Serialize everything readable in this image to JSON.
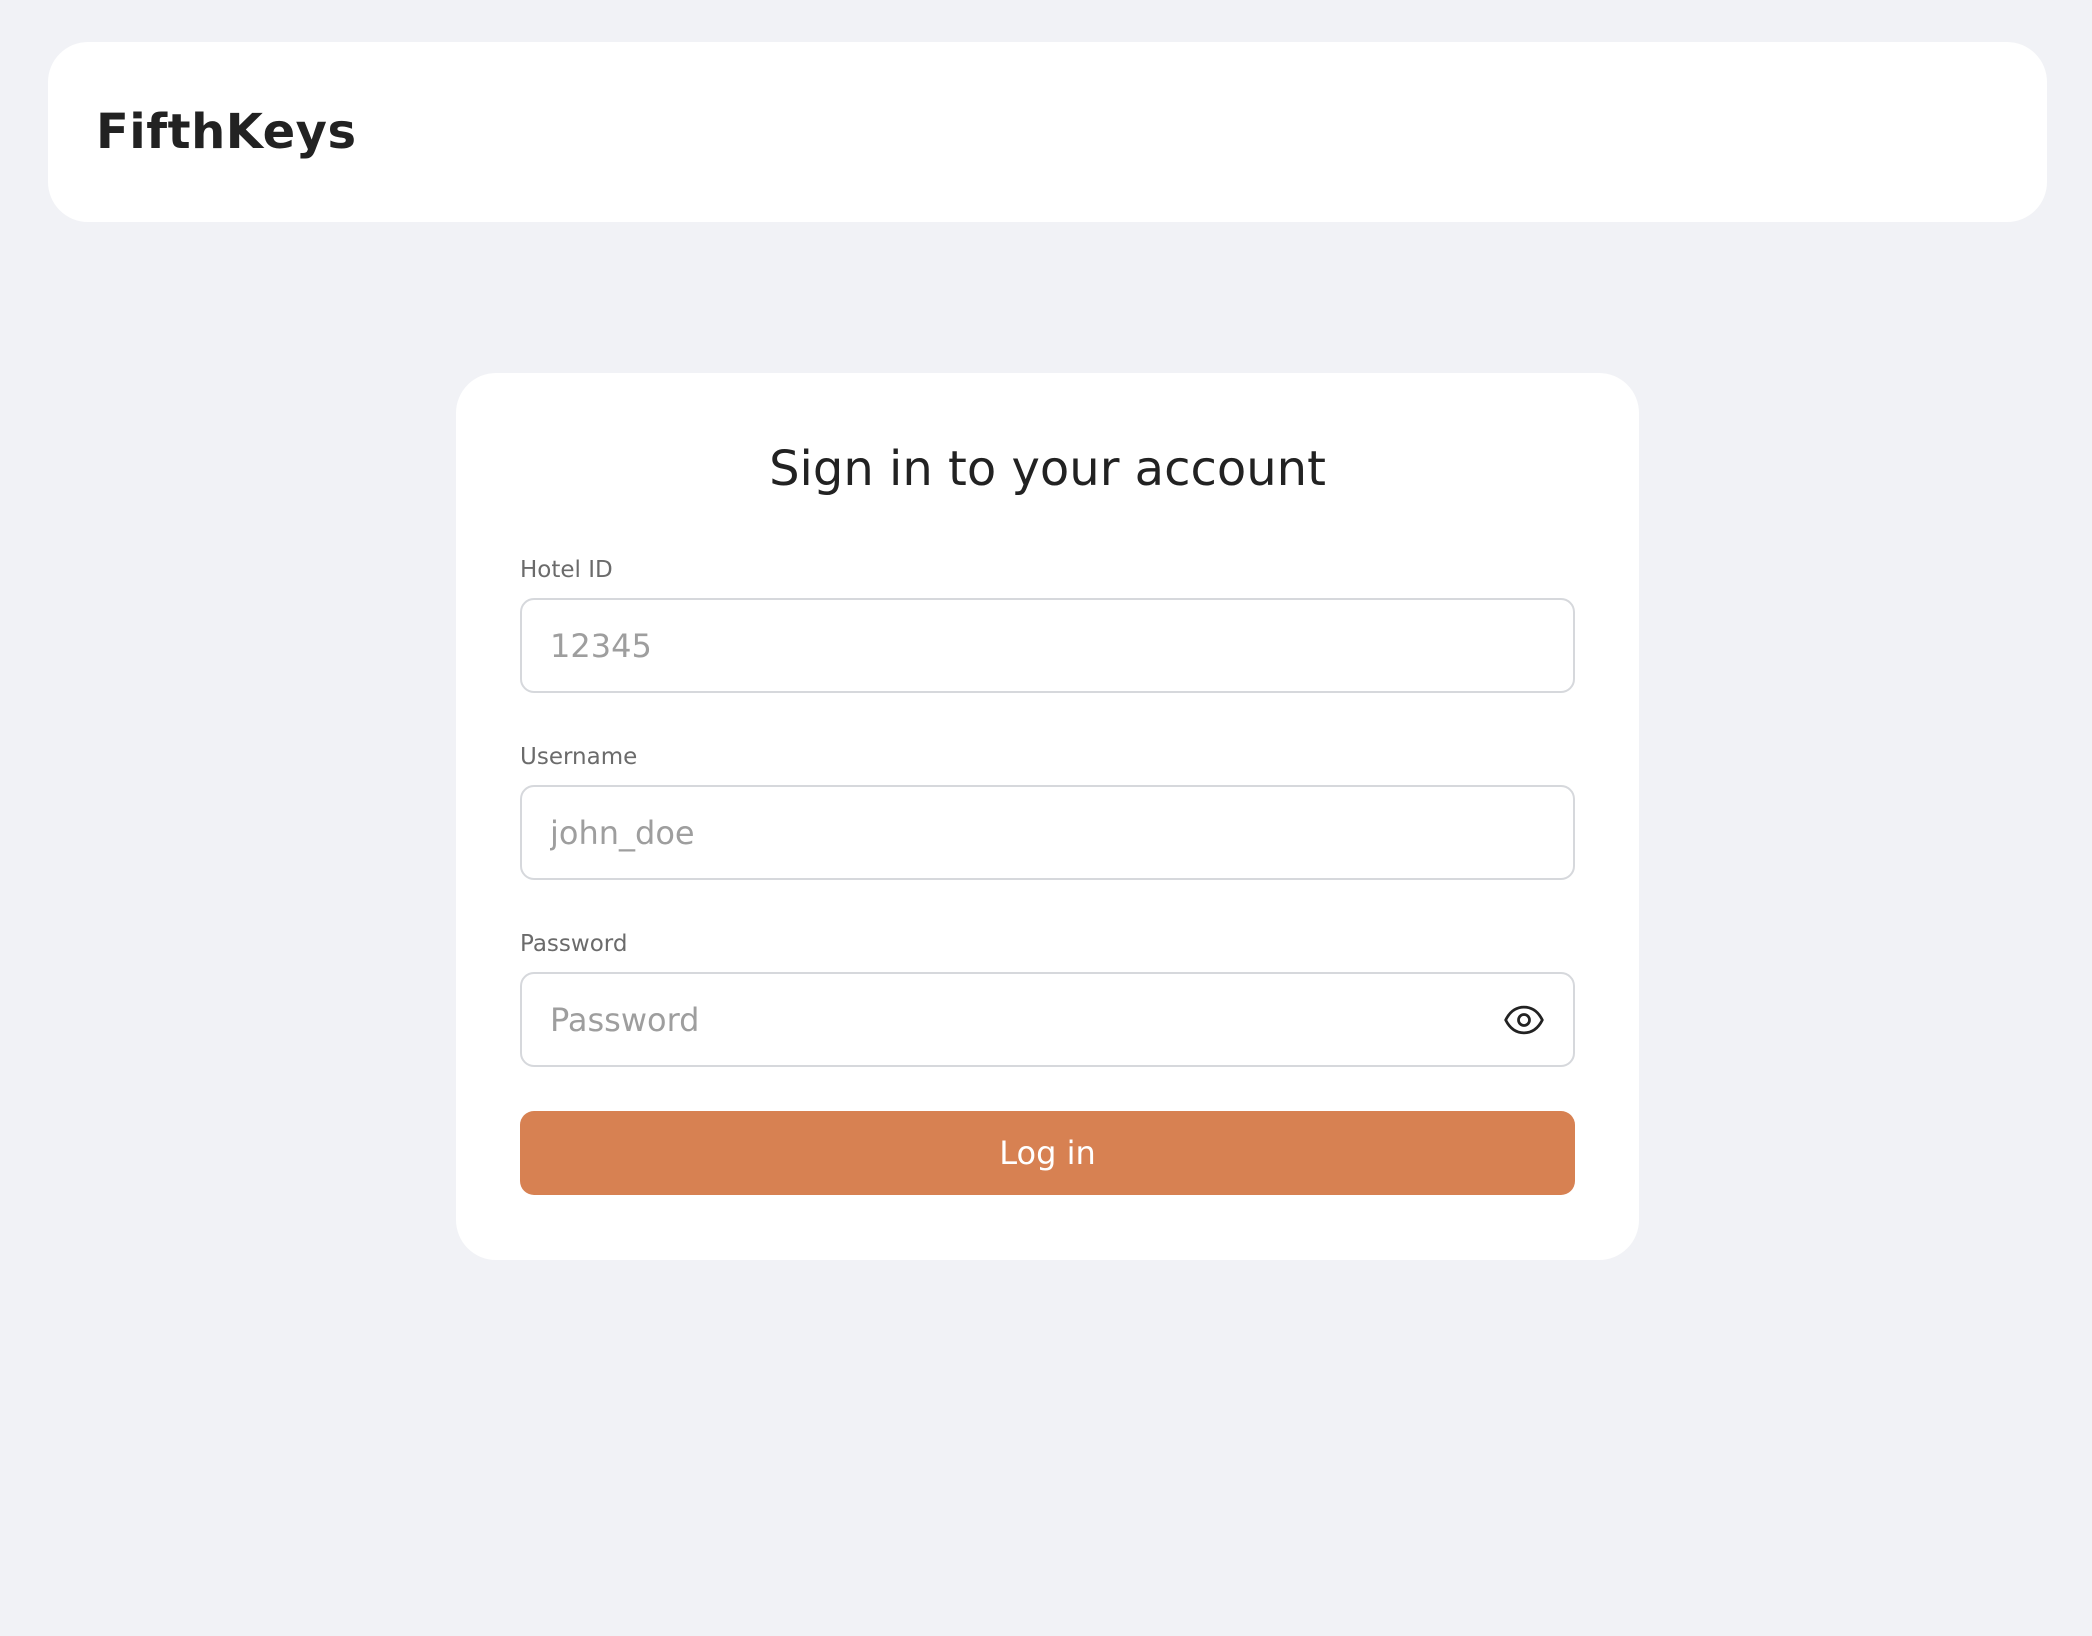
{
  "header": {
    "brand": "FifthKeys"
  },
  "login_card": {
    "title": "Sign in to your account",
    "fields": [
      {
        "label": "Hotel ID",
        "value": "",
        "placeholder": "12345"
      },
      {
        "label": "Username",
        "value": "",
        "placeholder": "john_doe"
      },
      {
        "label": "Password",
        "value": "",
        "placeholder": "Password",
        "toggle_icon": "eye-icon"
      }
    ],
    "submit_label": "Log in"
  },
  "colors": {
    "page_background": "#f1f2f6",
    "accent": "#d78152",
    "surface": "#ffffff"
  }
}
